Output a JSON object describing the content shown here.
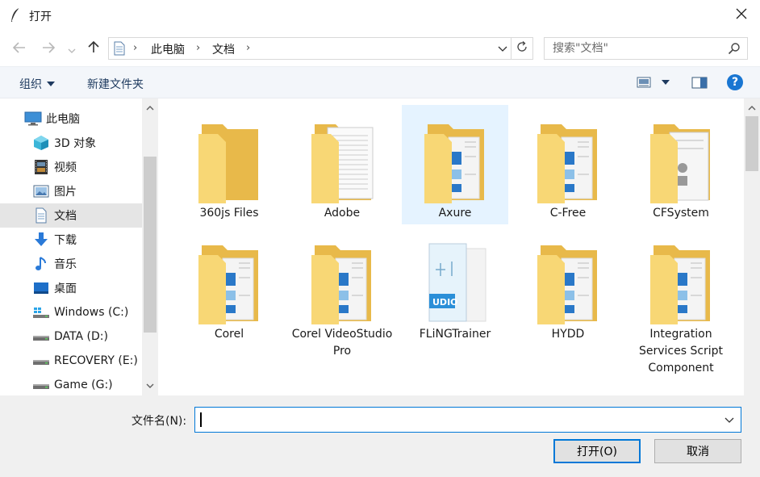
{
  "window": {
    "title": "打开"
  },
  "breadcrumb": {
    "items": [
      "此电脑",
      "文档"
    ]
  },
  "search": {
    "placeholder": "搜索\"文档\""
  },
  "toolbar": {
    "organize_label": "组织",
    "new_folder_label": "新建文件夹"
  },
  "navpane": {
    "items": [
      {
        "label": "此电脑",
        "icon": "computer-icon"
      },
      {
        "label": "3D 对象",
        "icon": "3d-objects-icon"
      },
      {
        "label": "视频",
        "icon": "video-icon"
      },
      {
        "label": "图片",
        "icon": "pictures-icon"
      },
      {
        "label": "文档",
        "icon": "documents-icon",
        "selected": true
      },
      {
        "label": "下载",
        "icon": "download-icon"
      },
      {
        "label": "音乐",
        "icon": "music-icon"
      },
      {
        "label": "桌面",
        "icon": "desktop-icon"
      },
      {
        "label": "Windows (C:)",
        "icon": "windows-drive-icon"
      },
      {
        "label": "DATA (D:)",
        "icon": "drive-icon"
      },
      {
        "label": "RECOVERY (E:)",
        "icon": "drive-icon"
      },
      {
        "label": "Game (G:)",
        "icon": "drive-icon"
      }
    ]
  },
  "files": [
    {
      "name": "360js Files",
      "type": "folder-empty"
    },
    {
      "name": "Adobe",
      "type": "folder-docs"
    },
    {
      "name": "Axure",
      "type": "folder-images",
      "hover": true
    },
    {
      "name": "C-Free",
      "type": "folder-images"
    },
    {
      "name": "CFSystem",
      "type": "folder-docs2"
    },
    {
      "name": "Corel",
      "type": "folder-images"
    },
    {
      "name": "Corel VideoStudio Pro",
      "type": "folder-images"
    },
    {
      "name": "FLiNGTrainer",
      "type": "folder-audio"
    },
    {
      "name": "HYDD",
      "type": "folder-images"
    },
    {
      "name": "Integration Services Script Component",
      "type": "folder-images"
    }
  ],
  "bottom": {
    "filename_label": "文件名(N):",
    "filename_value": "",
    "open_label": "打开(O)",
    "cancel_label": "取消"
  },
  "colors": {
    "accent": "#0078d7",
    "folder": "#f8d775",
    "folder_dark": "#e8b94a",
    "selection": "#e5f3ff"
  }
}
